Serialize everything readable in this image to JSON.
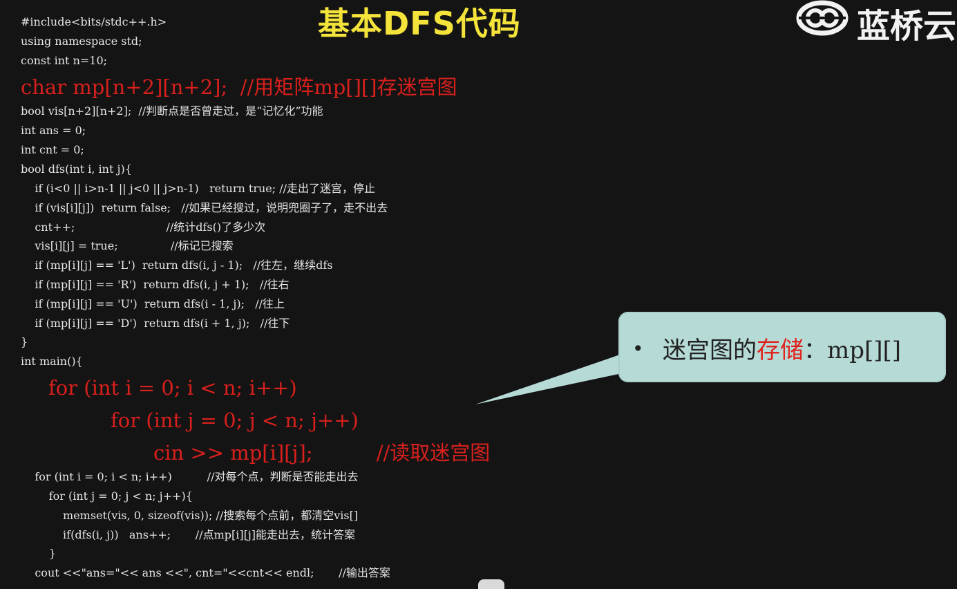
{
  "slide": {
    "title": "基本DFS代码",
    "logo_text": "蓝桥云"
  },
  "code_lines": [
    "#include<bits/stdc++.h>",
    "using namespace std;",
    "const int n=10;",
    "char mp[n+2][n+2];  //用矩阵mp[][]存迷宫图",
    "bool vis[n+2][n+2];  //判断点是否曾走过，是“记忆化”功能",
    "int ans = 0;",
    "int cnt = 0;",
    "bool dfs(int i, int j){",
    "    if (i<0 || i>n-1 || j<0 || j>n-1)   return true; //走出了迷宫，停止",
    "    if (vis[i][j])  return false;   //如果已经搜过，说明兜圈子了，走不出去",
    "    cnt++;                          //统计dfs()了多少次",
    "    vis[i][j] = true;               //标记已搜索",
    "    if (mp[i][j] == 'L')  return dfs(i, j - 1);   //往左，继续dfs",
    "    if (mp[i][j] == 'R')  return dfs(i, j + 1);   //往右",
    "    if (mp[i][j] == 'U')  return dfs(i - 1, j);   //往上",
    "    if (mp[i][j] == 'D')  return dfs(i + 1, j);   //往下",
    "}",
    "int main(){",
    "for (int i = 0; i < n; i++)",
    "for (int j = 0; j < n; j++)",
    "cin >> mp[i][j];          //读取迷宫图",
    "    for (int i = 0; i < n; i++)          //对每个点，判断是否能走出去",
    "        for (int j = 0; j < n; j++){",
    "            memset(vis, 0, sizeof(vis)); //搜索每个点前，都清空vis[]",
    "            if(dfs(i, j))   ans++;       //点mp[i][j]能走出去，统计答案",
    "        }",
    "    cout <<\"ans=\"<< ans <<\", cnt=\"<<cnt<< endl;       //输出答案"
  ],
  "callout": {
    "bullet": "•",
    "prefix": "迷宫图的",
    "highlight": "存储",
    "suffix": "：mp[][]"
  },
  "colors": {
    "background": "#141414",
    "title": "#f3e33a",
    "code": "#e6e6e6",
    "highlight_code": "#d8201d",
    "callout_bg": "#b6dbd7"
  }
}
